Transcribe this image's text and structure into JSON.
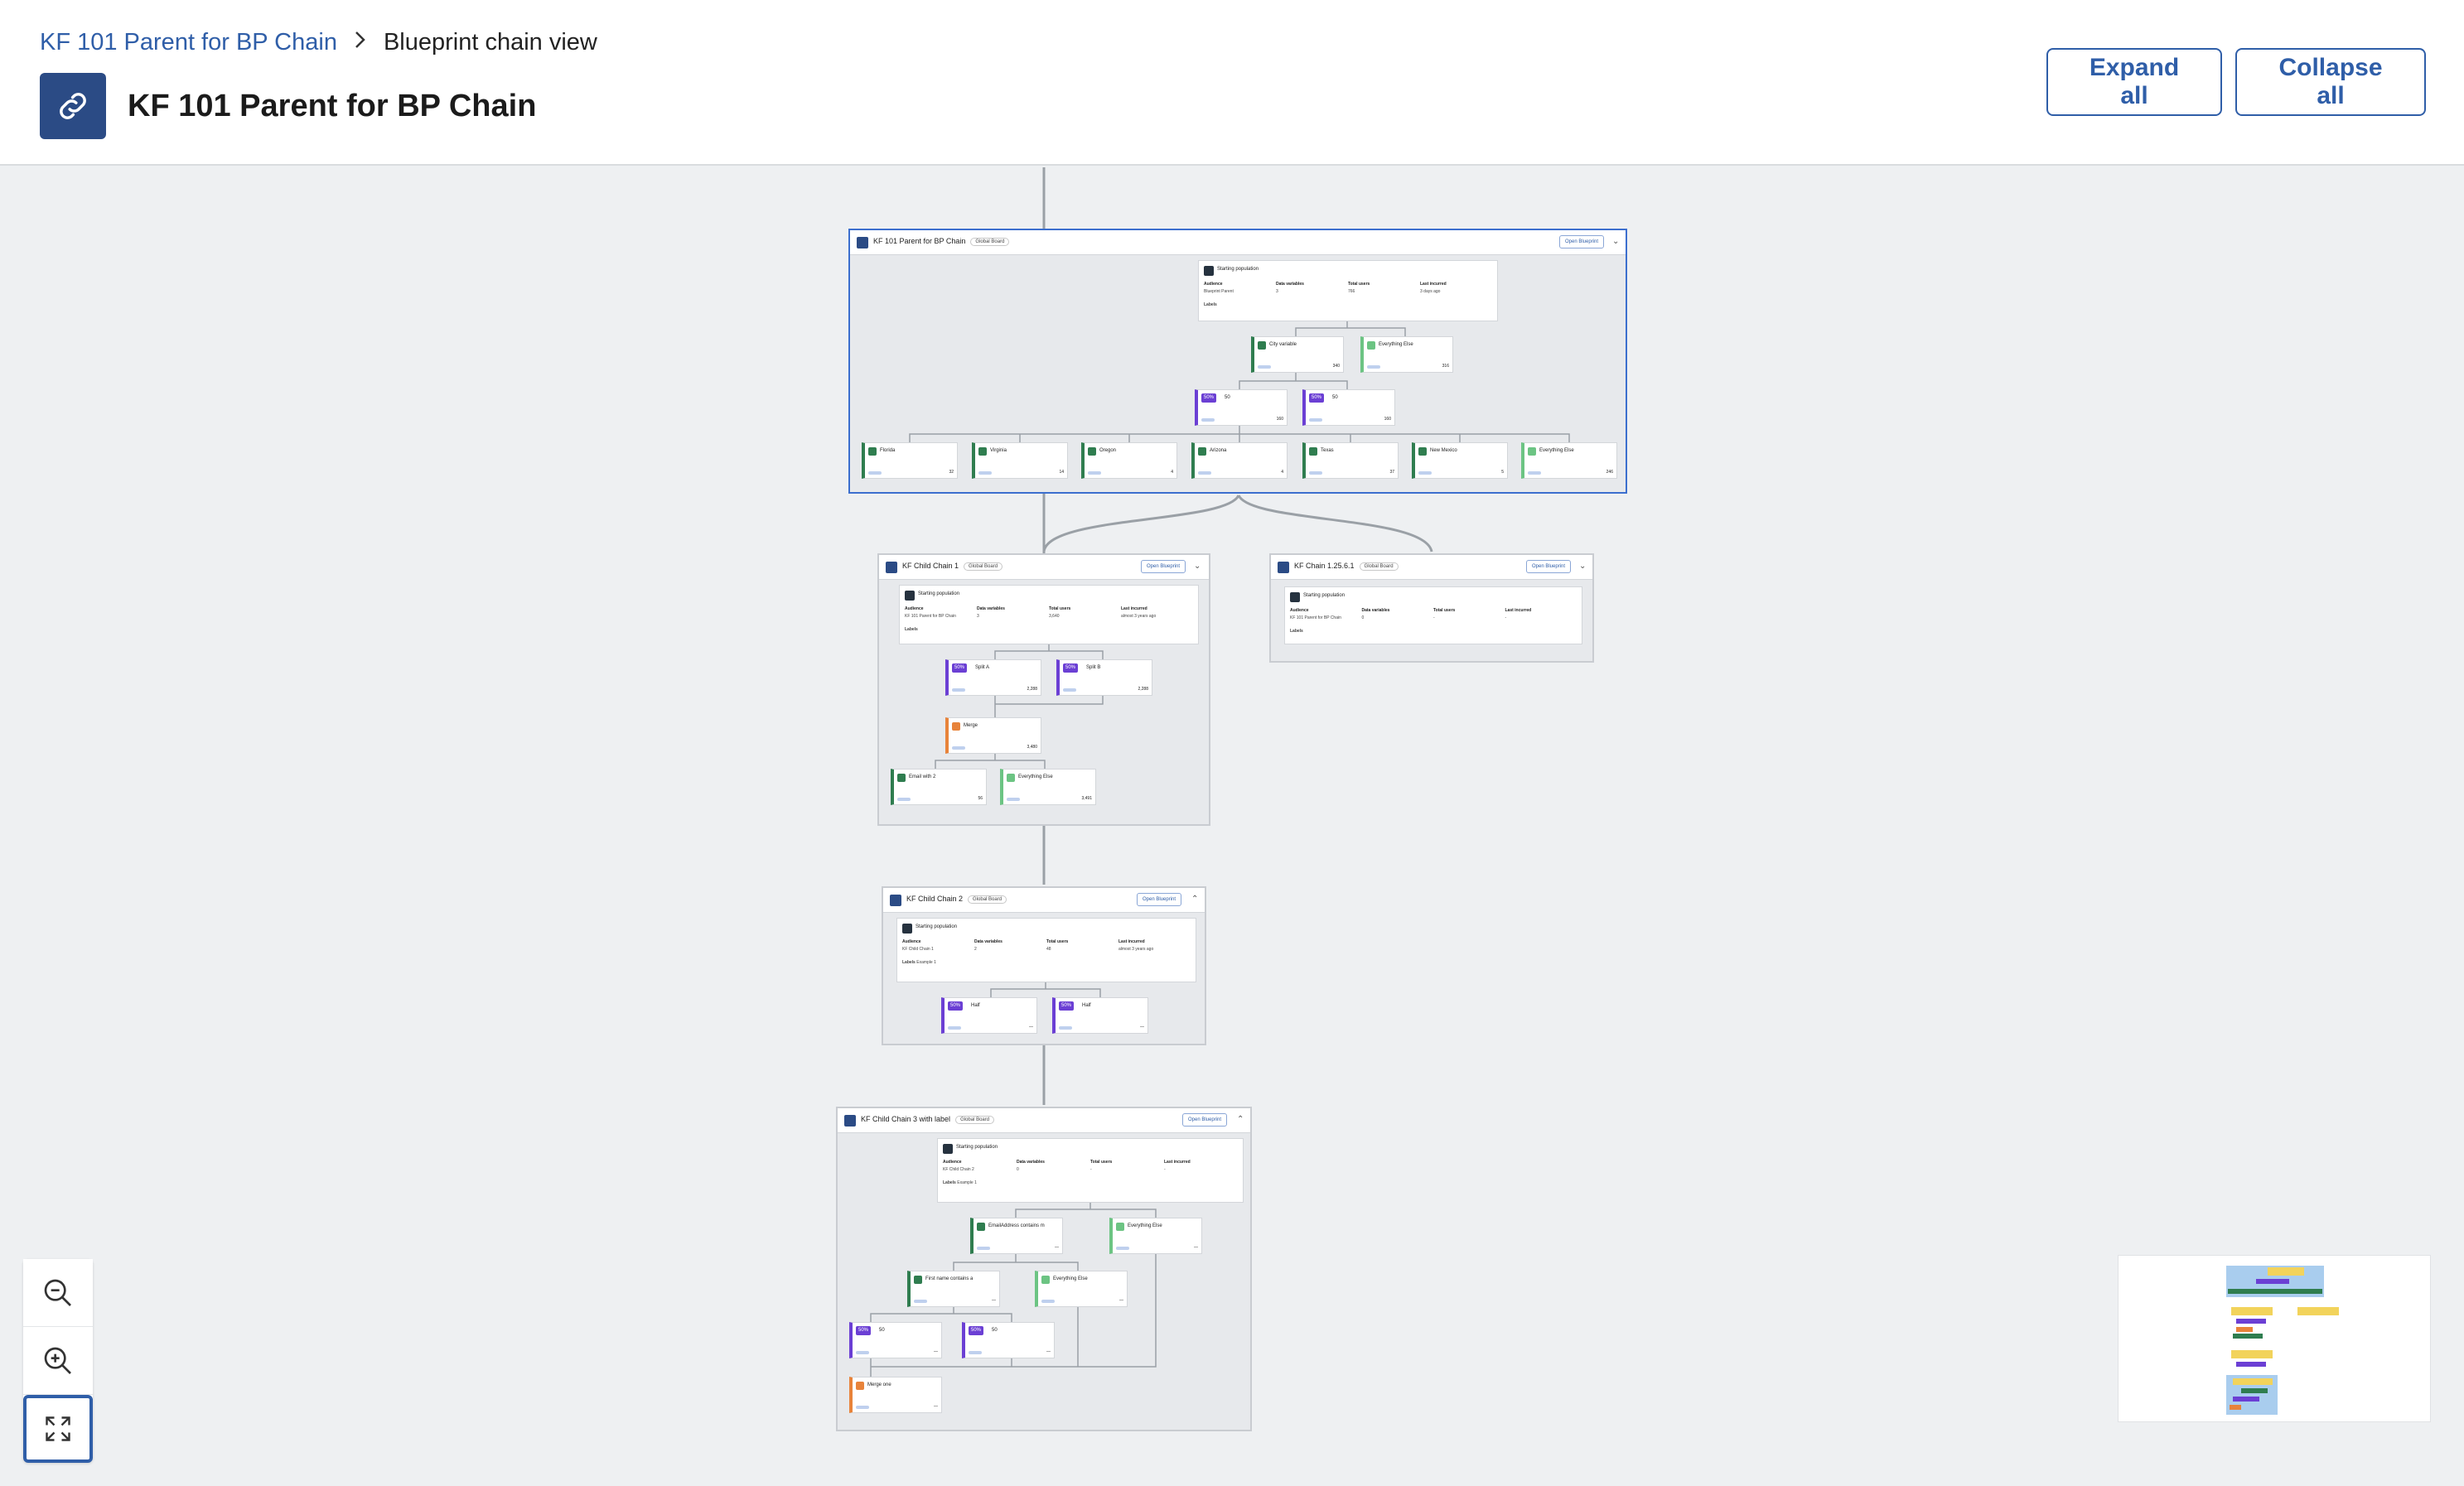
{
  "breadcrumb": {
    "parent": "KF 101 Parent for BP Chain",
    "current": "Blueprint chain view"
  },
  "header": {
    "title": "KF 101 Parent for BP Chain",
    "expand_all": "Expand all",
    "collapse_all": "Collapse all"
  },
  "common": {
    "open_blueprint": "Open Blueprint",
    "global_badge": "Global Board",
    "starting_population": "Starting population",
    "audience": "Audience",
    "data_variables": "Data variables",
    "total_users": "Total users",
    "last_incurred": "Last incurred",
    "labels": "Labels"
  },
  "chains": {
    "parent": {
      "title": "KF 101 Parent for BP Chain",
      "audience": "Blueprint Parent",
      "data_variables": "3",
      "total_users": "766",
      "last_incurred": "3 days ago",
      "nodes": [
        {
          "name": "City variable",
          "value": "340",
          "color": "dark-green"
        },
        {
          "name": "Everything Else",
          "value": "316",
          "color": "light-green"
        },
        {
          "name": "50",
          "pct": "50%",
          "value": "160",
          "color": "purple"
        },
        {
          "name": "50",
          "pct": "50%",
          "value": "160",
          "color": "purple"
        },
        {
          "name": "Florida",
          "value": "32",
          "color": "dark-green"
        },
        {
          "name": "Virginia",
          "value": "14",
          "color": "dark-green"
        },
        {
          "name": "Oregon",
          "value": "4",
          "color": "dark-green"
        },
        {
          "name": "Arizona",
          "value": "4",
          "color": "dark-green"
        },
        {
          "name": "Texas",
          "value": "37",
          "color": "dark-green"
        },
        {
          "name": "New Mexico",
          "value": "5",
          "color": "dark-green"
        },
        {
          "name": "Everything Else",
          "value": "246",
          "color": "light-green"
        }
      ]
    },
    "child1": {
      "title": "KF Child Chain 1",
      "audience": "KF 101 Parent for BP Chain",
      "data_variables": "3",
      "total_users": "3,640",
      "last_incurred": "almost 3 years ago",
      "nodes": [
        {
          "name": "Split A",
          "pct": "50%",
          "value": "2,288",
          "color": "purple"
        },
        {
          "name": "Split B",
          "pct": "50%",
          "value": "2,288",
          "color": "purple"
        },
        {
          "name": "Merge",
          "value": "3,480",
          "color": "orange"
        },
        {
          "name": "Email with 2",
          "value": "56",
          "color": "dark-green"
        },
        {
          "name": "Everything Else",
          "value": "3,491",
          "color": "light-green"
        }
      ]
    },
    "chain125": {
      "title": "KF Chain 1.25.6.1",
      "audience": "KF 101 Parent for BP Chain",
      "data_variables": "0",
      "total_users": "-",
      "last_incurred": "-"
    },
    "child2": {
      "title": "KF Child Chain 2",
      "audience": "KF Child Chain 1",
      "data_variables": "2",
      "total_users": "48",
      "last_incurred": "almost 3 years ago",
      "label": "Example 1",
      "nodes": [
        {
          "name": "Half",
          "pct": "50%",
          "value": "—",
          "color": "purple"
        },
        {
          "name": "Half",
          "pct": "50%",
          "value": "—",
          "color": "purple"
        }
      ]
    },
    "child3": {
      "title": "KF Child Chain 3 with label",
      "audience": "KF Child Chain 2",
      "data_variables": "0",
      "total_users": "-",
      "last_incurred": "-",
      "label": "Example 1",
      "nodes": [
        {
          "name": "EmailAddress contains m",
          "value": "—",
          "color": "dark-green"
        },
        {
          "name": "Everything Else",
          "value": "—",
          "color": "light-green"
        },
        {
          "name": "First name contains a",
          "value": "—",
          "color": "dark-green"
        },
        {
          "name": "Everything Else",
          "value": "—",
          "color": "light-green"
        },
        {
          "name": "50",
          "pct": "50%",
          "value": "—",
          "color": "purple"
        },
        {
          "name": "50",
          "pct": "50%",
          "value": "—",
          "color": "purple"
        },
        {
          "name": "Merge one",
          "value": "—",
          "color": "orange"
        }
      ]
    }
  },
  "colors": {
    "accent": "#2f5ea8",
    "title_icon": "#2b4b85",
    "dark_green": "#2f7d4f",
    "light_green": "#6cc483",
    "purple": "#6b3fd4",
    "orange": "#e8833a",
    "minimap_blue": "#a9cdee",
    "minimap_yellow": "#f2d35b"
  },
  "icons": {
    "title": "link-icon",
    "zoom_out": "zoom-out-icon",
    "zoom_in": "zoom-in-icon",
    "fit": "fit-screen-icon"
  }
}
